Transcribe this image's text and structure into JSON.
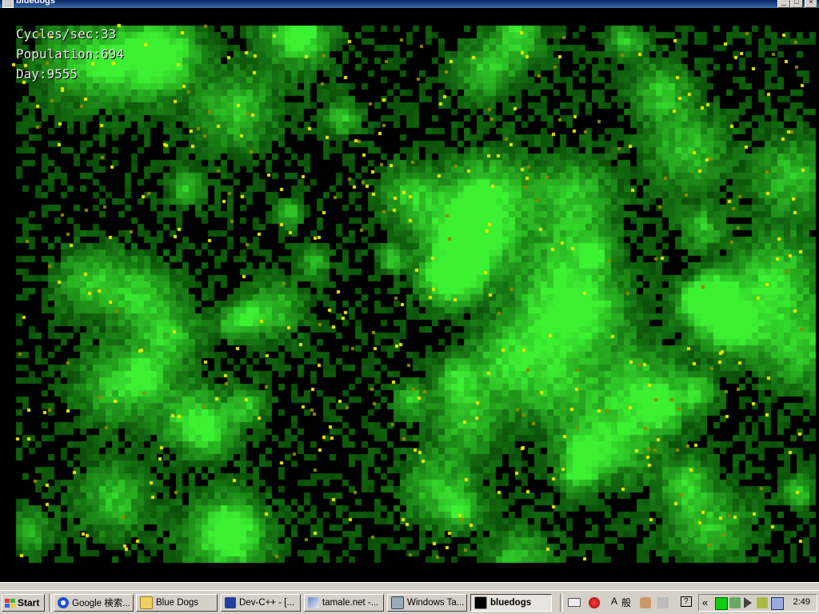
{
  "window": {
    "title": "bluedogs",
    "controls": {
      "minimize": "_",
      "maximize": "□",
      "close": "×"
    }
  },
  "hud": {
    "cycles_label": "Cycles/sec:",
    "cycles_value": "33",
    "population_label": "Population:",
    "population_value": "694",
    "day_label": "Day:",
    "day_value": "9555"
  },
  "simulation": {
    "colors": {
      "background": "#000000",
      "grass_dark": "#0a3a0a",
      "grass_bright": "#3fe83f",
      "dog": "#e8e800",
      "dog_dim": "#8a8a00"
    }
  },
  "taskbar": {
    "start_label": "Start",
    "tasks": [
      {
        "label": "Google 検索...",
        "icon": "google-icon",
        "active": false
      },
      {
        "label": "Blue Dogs",
        "icon": "folder-icon",
        "active": false
      },
      {
        "label": "Dev-C++ - [...",
        "icon": "devcpp-icon",
        "active": false
      },
      {
        "label": "tamale.net -...",
        "icon": "putty-icon",
        "active": false
      },
      {
        "label": "Windows Ta...",
        "icon": "taskmgr-icon",
        "active": false
      },
      {
        "label": "bluedogs",
        "icon": "console-icon",
        "active": true
      }
    ],
    "quicklaunch": [
      "keyboard-icon",
      "ime-icon",
      "ime-a-label",
      "ime-kanji-label",
      "tools-icon",
      "pen-icon",
      "help-icon"
    ],
    "ime_a": "A",
    "ime_kanji": "般",
    "help": "?",
    "tray_expand": "«",
    "clock": "2:49"
  }
}
